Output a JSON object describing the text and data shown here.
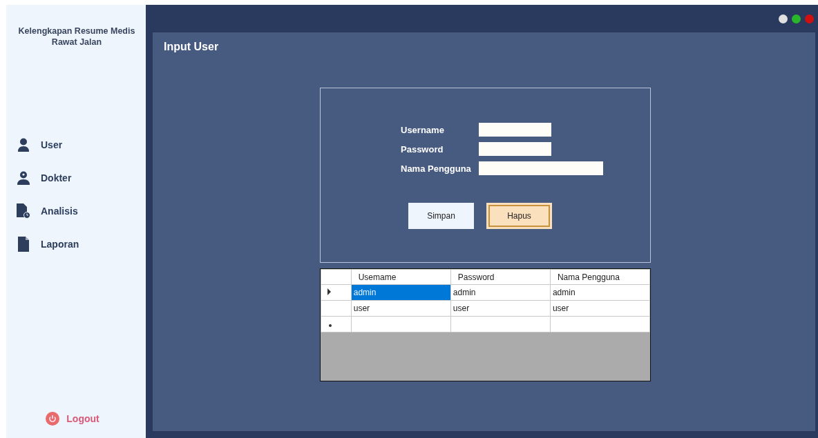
{
  "sidebar": {
    "title": "Kelengkapan Resume Medis Rawat Jalan",
    "items": [
      {
        "label": "User",
        "selected": false
      },
      {
        "label": "Dokter",
        "selected": false
      },
      {
        "label": "Analisis",
        "selected": false
      },
      {
        "label": "Laporan",
        "selected": false
      }
    ],
    "logout": "Logout"
  },
  "window_controls": [
    {
      "color": "#e0e0e0"
    },
    {
      "color": "#2bb52b"
    },
    {
      "color": "#d01010"
    }
  ],
  "page_title": "Input User",
  "form": {
    "fields": [
      {
        "label": "Username"
      },
      {
        "label": "Password"
      },
      {
        "label": "Nama Pengguna"
      }
    ],
    "buttons": [
      {
        "label": "Simpan",
        "focused": false
      },
      {
        "label": "Hapus",
        "focused": true
      }
    ]
  },
  "table": {
    "columns": [
      "Usemame",
      "Password",
      "Nama Pengguna"
    ],
    "rows": [
      {
        "kind": "data",
        "current": true,
        "cells": [
          {
            "text": "admin",
            "selected": true
          },
          {
            "text": "admin",
            "selected": false
          },
          {
            "text": "admin",
            "selected": false
          }
        ]
      },
      {
        "kind": "data",
        "current": false,
        "cells": [
          {
            "text": "user",
            "selected": false
          },
          {
            "text": "user",
            "selected": false
          },
          {
            "text": "user",
            "selected": false
          }
        ]
      },
      {
        "kind": "new"
      }
    ]
  }
}
